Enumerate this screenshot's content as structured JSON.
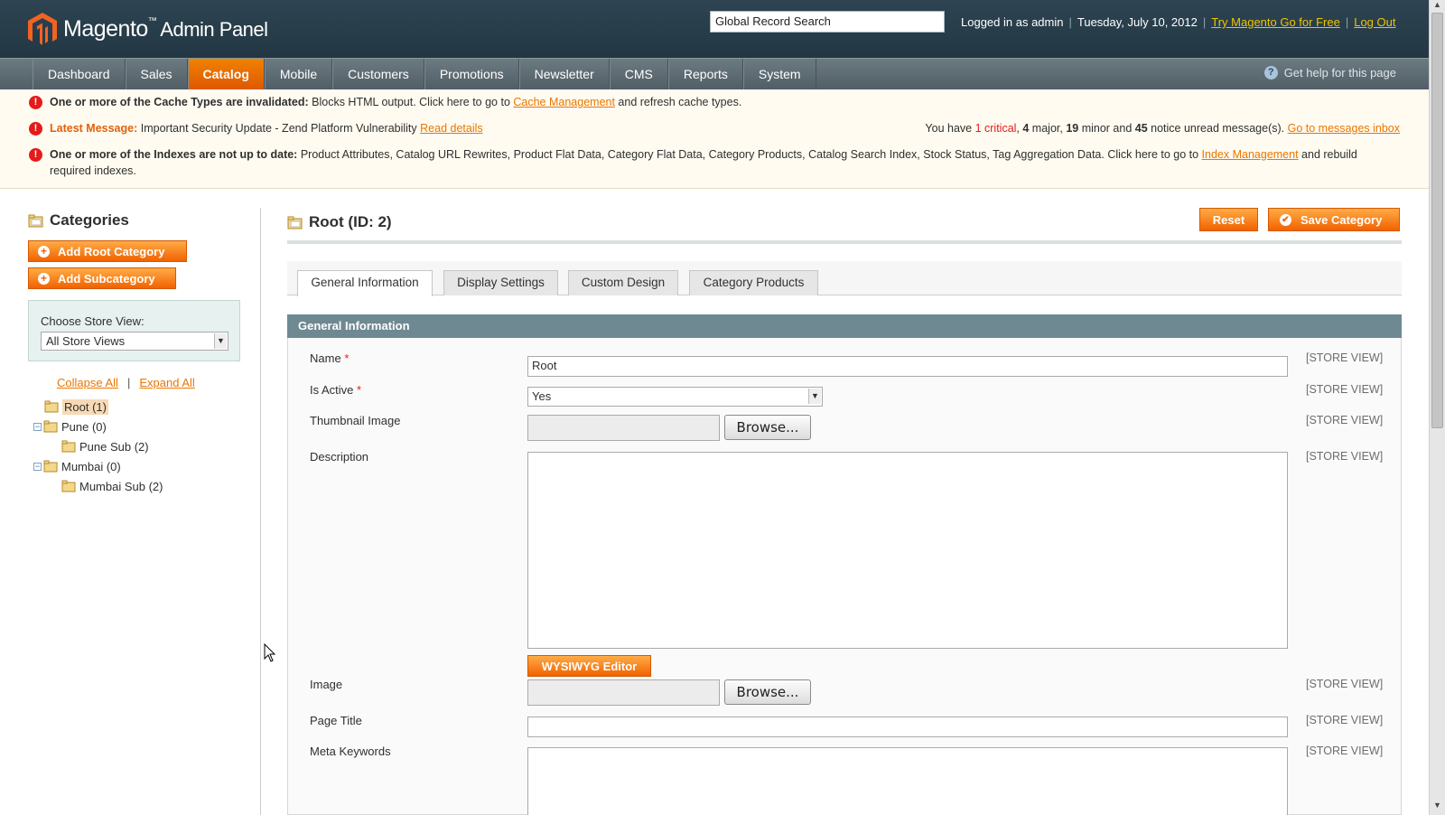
{
  "header": {
    "logo_text": "Magento",
    "logo_tm": "™",
    "logo_panel": "Admin Panel",
    "search_value": "Global Record Search",
    "logged_in": "Logged in as admin",
    "date": "Tuesday, July 10, 2012",
    "try_link": "Try Magento Go for Free",
    "logout_link": "Log Out"
  },
  "nav": {
    "items": [
      {
        "label": "Dashboard"
      },
      {
        "label": "Sales"
      },
      {
        "label": "Catalog"
      },
      {
        "label": "Mobile"
      },
      {
        "label": "Customers"
      },
      {
        "label": "Promotions"
      },
      {
        "label": "Newsletter"
      },
      {
        "label": "CMS"
      },
      {
        "label": "Reports"
      },
      {
        "label": "System"
      }
    ],
    "active": "Catalog",
    "help_text": "Get help for this page"
  },
  "messages": {
    "cache": {
      "bold": "One or more of the Cache Types are invalidated:",
      "text": " Blocks HTML output. Click here to go to ",
      "link": "Cache Management",
      "after": " and refresh cache types."
    },
    "latest": {
      "bold": "Latest Message:",
      "text": " Important Security Update - Zend Platform Vulnerability ",
      "link": "Read details",
      "right_prefix": "You have ",
      "critical": "1 critical",
      "sep1": ", ",
      "major": "4",
      "major_label": " major, ",
      "minor": "19",
      "minor_label": " minor and ",
      "notice": "45",
      "notice_label": " notice unread message(s). ",
      "inbox_link": "Go to messages inbox"
    },
    "indexes": {
      "bold": "One or more of the Indexes are not up to date:",
      "text": " Product Attributes, Catalog URL Rewrites, Product Flat Data, Category Flat Data, Category Products, Catalog Search Index, Stock Status, Tag Aggregation Data. Click here to go to ",
      "link": "Index Management",
      "after": " and rebuild",
      "line2": "required indexes."
    }
  },
  "sidebar": {
    "title": "Categories",
    "add_root": "Add Root Category",
    "add_sub": "Add Subcategory",
    "store_label": "Choose Store View:",
    "store_value": "All Store Views",
    "collapse_all": "Collapse All",
    "separator": "|",
    "expand_all": "Expand All",
    "tree": [
      {
        "label": "Root (1)"
      },
      {
        "label": "Pune (0)"
      },
      {
        "label": "Pune Sub (2)"
      },
      {
        "label": "Mumbai (0)"
      },
      {
        "label": "Mumbai Sub (2)"
      }
    ]
  },
  "main": {
    "title": "Root (ID: 2)",
    "reset": "Reset",
    "save": "Save Category",
    "tabs": [
      {
        "label": "General Information"
      },
      {
        "label": "Display Settings"
      },
      {
        "label": "Custom Design"
      },
      {
        "label": "Category Products"
      }
    ],
    "section_title": "General Information",
    "scope": "[STORE VIEW]",
    "required_mark": "*",
    "fields": {
      "name_label": "Name",
      "name_value": "Root",
      "active_label": "Is Active",
      "active_value": "Yes",
      "thumb_label": "Thumbnail Image",
      "browse": "Browse...",
      "desc_label": "Description",
      "wysiwyg": "WYSIWYG Editor",
      "image_label": "Image",
      "page_title_label": "Page Title",
      "meta_label": "Meta Keywords"
    }
  },
  "colors": {
    "header_bg": "#223743",
    "accent": "#f16200",
    "link": "#ea7601",
    "section_bg": "#6f8992"
  }
}
